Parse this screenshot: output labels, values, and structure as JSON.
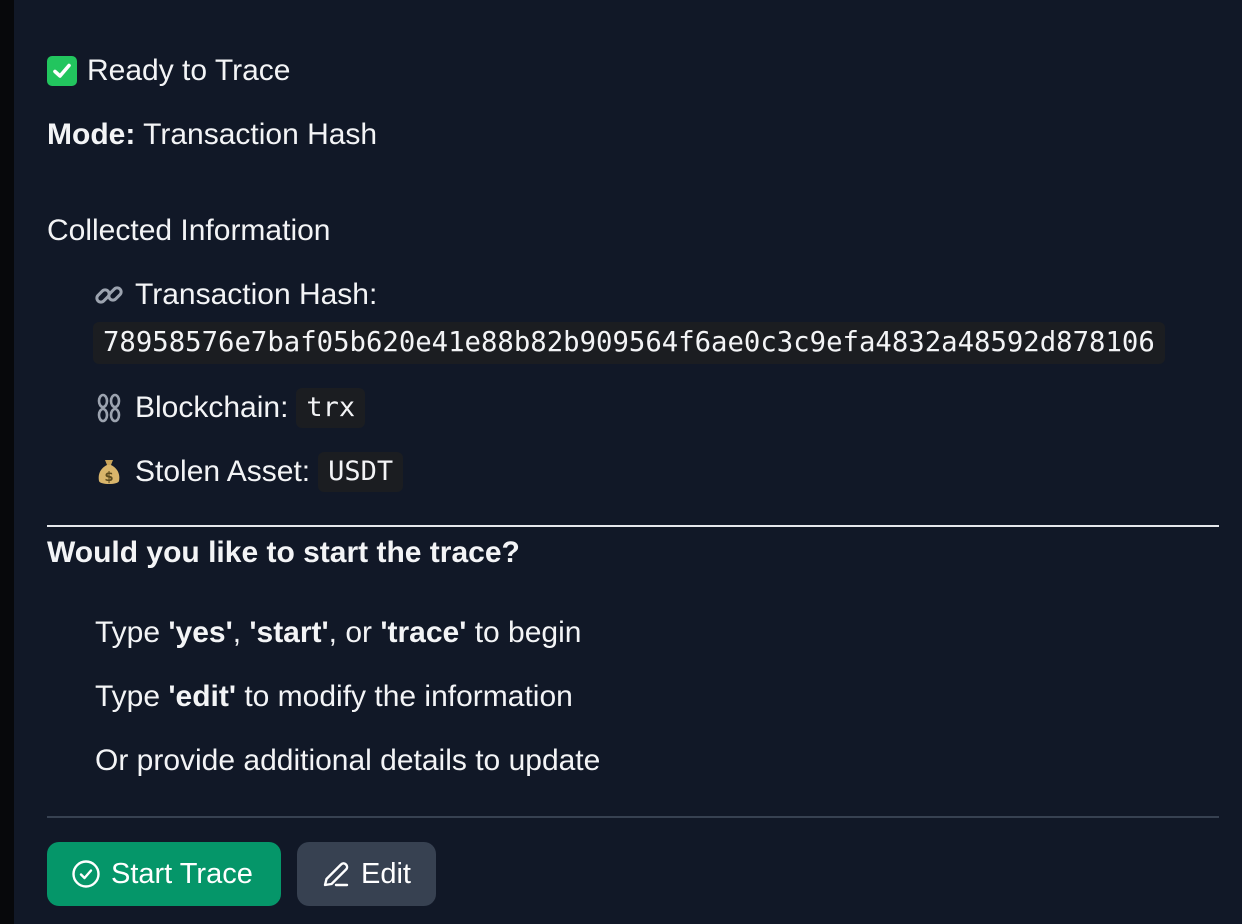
{
  "status": {
    "icon": "check-mark-button-icon",
    "text": "Ready to Trace"
  },
  "mode": {
    "label": "Mode:",
    "value": "Transaction Hash"
  },
  "collected": {
    "title": "Collected Information",
    "items": [
      {
        "icon": "link-icon",
        "label": "Transaction Hash:",
        "value": "78958576e7baf05b620e41e88b82b909564f6ae0c3c9efa4832a48592d878106"
      },
      {
        "icon": "chains-icon",
        "label": "Blockchain:",
        "value": "trx"
      },
      {
        "icon": "money-bag-icon",
        "label": "Stolen Asset:",
        "value": "USDT"
      }
    ]
  },
  "prompt": {
    "question": "Would you like to start the trace?",
    "line1": {
      "pre": "Type ",
      "yes": "'yes'",
      "comma1": ", ",
      "start": "'start'",
      "or": ", or ",
      "trace": "'trace'",
      "post": " to begin"
    },
    "line2": {
      "pre": "Type ",
      "edit": "'edit'",
      "post": " to modify the information"
    },
    "line3": "Or provide additional details to update"
  },
  "actions": {
    "start_label": "Start Trace",
    "edit_label": "Edit"
  },
  "colors": {
    "background": "#111827",
    "start_button": "#059669",
    "edit_button": "#374151",
    "check": "#22c55e"
  }
}
